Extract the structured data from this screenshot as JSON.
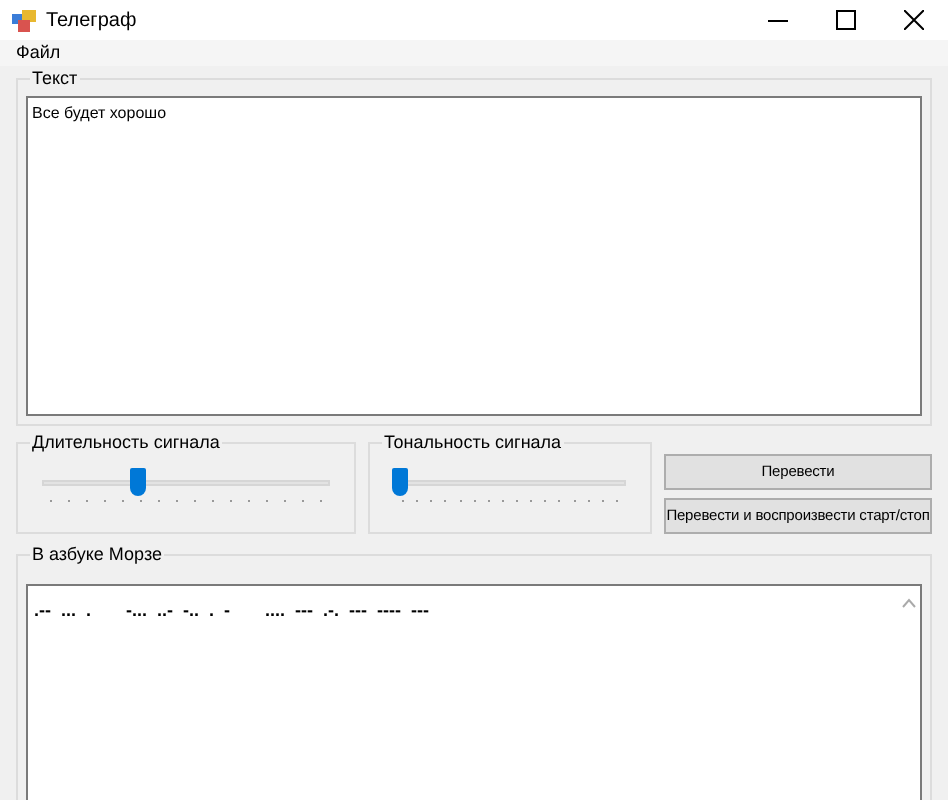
{
  "window": {
    "title": "Телеграф"
  },
  "menu": [
    "Файл"
  ],
  "text_group": {
    "title": "Текст",
    "value": "Все будет хорошо"
  },
  "sliders": [
    {
      "label": "Длительность сигнала",
      "level": 0.33
    },
    {
      "label": "Тональность сигнала",
      "level": 0.03
    }
  ],
  "buttons": [
    "Перевести",
    "Перевести и воспроизвести старт/стоп"
  ],
  "morse_group": {
    "title": "В азбуке Морзе",
    "value": ".--  ...  .       -...  ..-  -..  .  -       ....  ---  .-.  ---  ----  ---"
  }
}
